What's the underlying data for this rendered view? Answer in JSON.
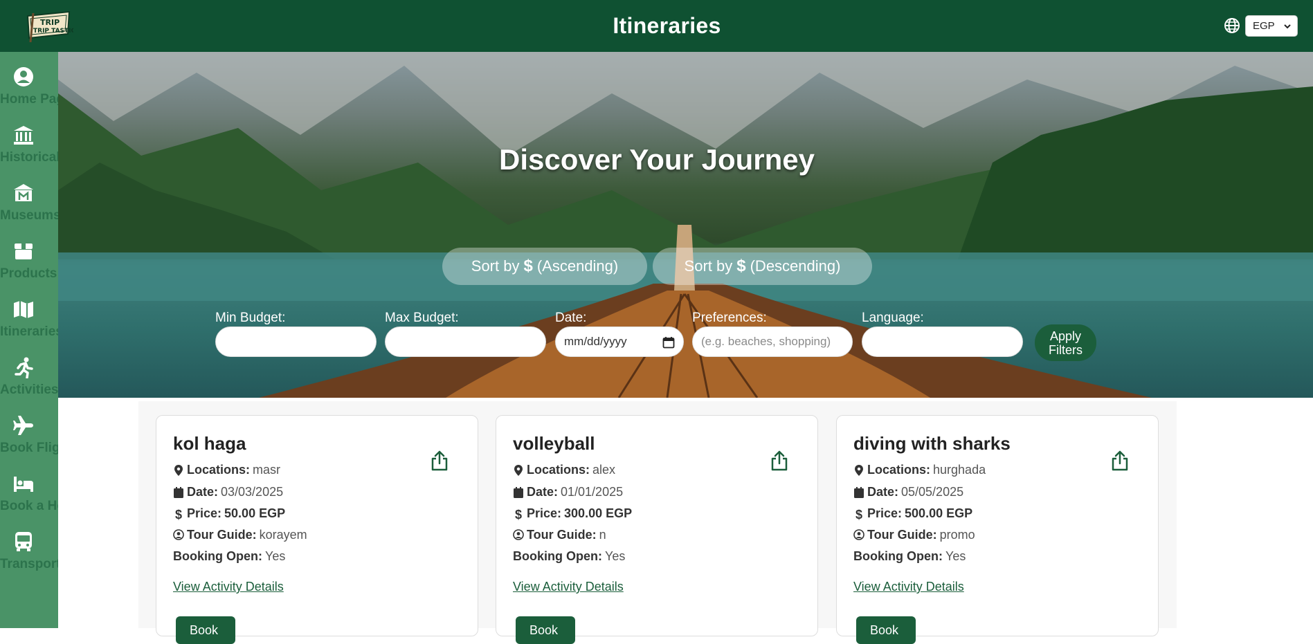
{
  "header": {
    "title": "Itineraries",
    "logo_text": "TRIP TASTIC",
    "currency": "EGP",
    "accent_color": "#0f5132"
  },
  "sidebar": {
    "items": [
      {
        "label": "Home Page",
        "icon": "user-circle-icon"
      },
      {
        "label": "Historical Places",
        "icon": "landmark-icon"
      },
      {
        "label": "Museums",
        "icon": "museum-icon"
      },
      {
        "label": "Products",
        "icon": "box-icon"
      },
      {
        "label": "Itineraries",
        "icon": "map-icon"
      },
      {
        "label": "Activities",
        "icon": "running-icon"
      },
      {
        "label": "Book Flights",
        "icon": "plane-icon"
      },
      {
        "label": "Book a Hotel",
        "icon": "bed-icon"
      },
      {
        "label": "Transportation",
        "icon": "bus-icon"
      }
    ]
  },
  "hero": {
    "title": "Discover Your Journey",
    "sort_asc": {
      "prefix": "Sort by",
      "symbol": "$",
      "suffix": "(Ascending)"
    },
    "sort_desc": {
      "prefix": "Sort by",
      "symbol": "$",
      "suffix": "(Descending)"
    }
  },
  "filters": {
    "min_budget_label": "Min Budget:",
    "max_budget_label": "Max Budget:",
    "date_label": "Date:",
    "date_placeholder": "mm/dd/yyyy",
    "preferences_label": "Preferences:",
    "preferences_placeholder": "(e.g. beaches, shopping)",
    "language_label": "Language:",
    "apply_label": "Apply Filters"
  },
  "labels": {
    "locations": "Locations:",
    "date": "Date:",
    "price": "Price:",
    "tour_guide": "Tour Guide:",
    "booking_open": "Booking Open:",
    "details_link": "View Activity Details",
    "book_button": "Book"
  },
  "cards": [
    {
      "title": "kol haga",
      "location": "masr",
      "date": "03/03/2025",
      "price": "50.00 EGP",
      "tour_guide": "korayem",
      "booking_open": "Yes"
    },
    {
      "title": "volleyball",
      "location": "alex",
      "date": "01/01/2025",
      "price": "300.00 EGP",
      "tour_guide": "n",
      "booking_open": "Yes"
    },
    {
      "title": "diving with sharks",
      "location": "hurghada",
      "date": "05/05/2025",
      "price": "500.00 EGP",
      "tour_guide": "promo",
      "booking_open": "Yes"
    }
  ]
}
